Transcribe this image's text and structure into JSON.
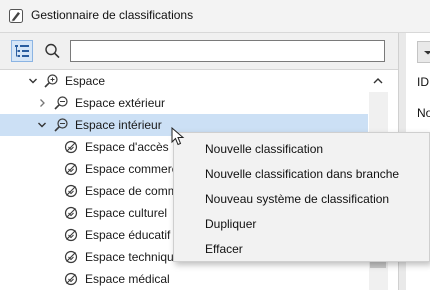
{
  "window": {
    "title": "Gestionnaire de classifications",
    "app_icon": "archicad-logo"
  },
  "toolbar": {
    "tree_view_icon": "tree-list-icon",
    "search_icon": "search-icon",
    "search": {
      "value": "",
      "placeholder": ""
    }
  },
  "right_pane": {
    "dropdown_icon": "chevron-down-icon",
    "id_label": "ID",
    "name_label": "No"
  },
  "tree": {
    "rows": [
      {
        "label": "Espace",
        "level": 0,
        "expander": "expanded",
        "icon": "classification-system-icon",
        "selected": false
      },
      {
        "label": "Espace extérieur",
        "level": 1,
        "expander": "collapsed",
        "icon": "classification-branch-icon",
        "selected": false
      },
      {
        "label": "Espace intérieur",
        "level": 1,
        "expander": "expanded",
        "icon": "classification-branch-icon",
        "selected": true
      },
      {
        "label": "Espace d'accès",
        "level": 2,
        "expander": "none",
        "icon": "classification-leaf-icon",
        "selected": false
      },
      {
        "label": "Espace commercial",
        "level": 2,
        "expander": "none",
        "icon": "classification-leaf-icon",
        "selected": false
      },
      {
        "label": "Espace de communication",
        "level": 2,
        "expander": "none",
        "icon": "classification-leaf-icon",
        "selected": false
      },
      {
        "label": "Espace culturel",
        "level": 2,
        "expander": "none",
        "icon": "classification-leaf-icon",
        "selected": false
      },
      {
        "label": "Espace éducatif",
        "level": 2,
        "expander": "none",
        "icon": "classification-leaf-icon",
        "selected": false
      },
      {
        "label": "Espace technique",
        "level": 2,
        "expander": "none",
        "icon": "classification-leaf-icon",
        "selected": false
      },
      {
        "label": "Espace médical",
        "level": 2,
        "expander": "none",
        "icon": "classification-leaf-icon",
        "selected": false
      }
    ]
  },
  "context_menu": {
    "items": [
      "Nouvelle classification",
      "Nouvelle classification dans branche",
      "Nouveau système de classification",
      "Dupliquer",
      "Effacer"
    ]
  },
  "colors": {
    "selection": "#cce0f5",
    "accent": "#8bb4e3",
    "icon": "#3a3a3a"
  }
}
